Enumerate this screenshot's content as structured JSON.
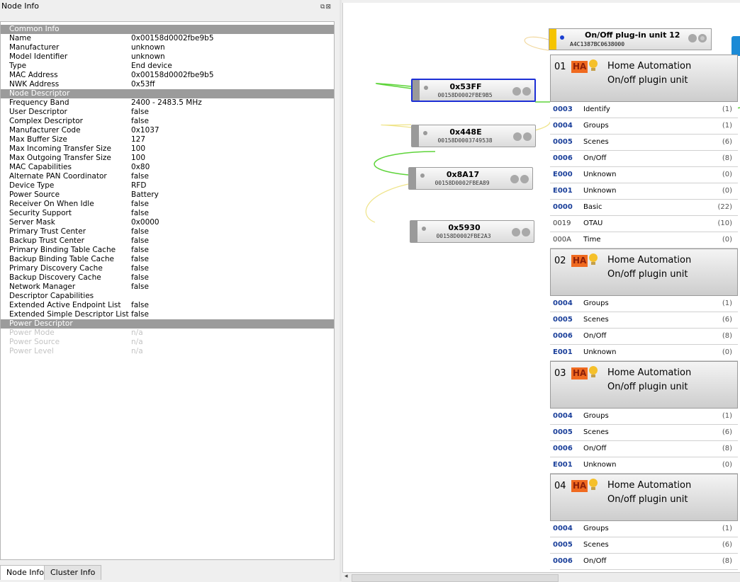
{
  "dock": {
    "title": "Node Info",
    "float_icon": "float-icon",
    "close_icon": "close-icon"
  },
  "node_info": {
    "rows": [
      {
        "kind": "section",
        "key": "Common Info",
        "value": ""
      },
      {
        "kind": "row",
        "key": "Name",
        "value": "0x00158d0002fbe9b5"
      },
      {
        "kind": "row",
        "key": "Manufacturer",
        "value": "unknown"
      },
      {
        "kind": "row",
        "key": "Model Identifier",
        "value": "unknown"
      },
      {
        "kind": "row",
        "key": "Type",
        "value": "End device"
      },
      {
        "kind": "row",
        "key": "MAC Address",
        "value": "0x00158d0002fbe9b5"
      },
      {
        "kind": "row",
        "key": "NWK Address",
        "value": "0x53ff"
      },
      {
        "kind": "section",
        "key": "Node Descriptor",
        "value": ""
      },
      {
        "kind": "row",
        "key": "Frequency Band",
        "value": "2400 - 2483.5 MHz"
      },
      {
        "kind": "row",
        "key": "User Descriptor",
        "value": "false"
      },
      {
        "kind": "row",
        "key": "Complex Descriptor",
        "value": "false"
      },
      {
        "kind": "row",
        "key": "Manufacturer Code",
        "value": "0x1037"
      },
      {
        "kind": "row",
        "key": "Max Buffer Size",
        "value": "127"
      },
      {
        "kind": "row",
        "key": "Max Incoming Transfer Size",
        "value": "100"
      },
      {
        "kind": "row",
        "key": "Max Outgoing Transfer Size",
        "value": "100"
      },
      {
        "kind": "row",
        "key": "MAC Capabilities",
        "value": "0x80"
      },
      {
        "kind": "row",
        "key": "Alternate PAN Coordinator",
        "value": "false"
      },
      {
        "kind": "row",
        "key": "Device Type",
        "value": "RFD"
      },
      {
        "kind": "row",
        "key": "Power Source",
        "value": "Battery"
      },
      {
        "kind": "row",
        "key": "Receiver On When Idle",
        "value": "false"
      },
      {
        "kind": "row",
        "key": "Security Support",
        "value": "false"
      },
      {
        "kind": "row",
        "key": "Server Mask",
        "value": "0x0000"
      },
      {
        "kind": "row",
        "key": "Primary Trust Center",
        "value": "false"
      },
      {
        "kind": "row",
        "key": "Backup Trust Center",
        "value": "false"
      },
      {
        "kind": "row",
        "key": "Primary Binding Table Cache",
        "value": "false"
      },
      {
        "kind": "row",
        "key": "Backup Binding Table Cache",
        "value": "false"
      },
      {
        "kind": "row",
        "key": "Primary Discovery Cache",
        "value": "false"
      },
      {
        "kind": "row",
        "key": "Backup Discovery Cache",
        "value": "false"
      },
      {
        "kind": "row",
        "key": "Network Manager",
        "value": "false"
      },
      {
        "kind": "row",
        "key": "Descriptor Capabilities",
        "value": ""
      },
      {
        "kind": "row",
        "key": "Extended Active Endpoint List",
        "value": "false"
      },
      {
        "kind": "row",
        "key": "Extended Simple Descriptor List",
        "value": "false"
      },
      {
        "kind": "section",
        "key": "Power Descriptor",
        "value": ""
      },
      {
        "kind": "dim",
        "key": "Power Mode",
        "value": "n/a"
      },
      {
        "kind": "dim",
        "key": "Power Source",
        "value": "n/a"
      },
      {
        "kind": "dim",
        "key": "Power Level",
        "value": "n/a"
      }
    ]
  },
  "tabs": [
    {
      "label": "Node Info",
      "active": true
    },
    {
      "label": "Cluster Info",
      "active": false
    }
  ],
  "nodes": [
    {
      "name": "0x53FF",
      "mac": "00158D0002FBE9B5",
      "selected": true
    },
    {
      "name": "0x448E",
      "mac": "00158D0003749538",
      "selected": false
    },
    {
      "name": "0x8A17",
      "mac": "00158D0002FBEA89",
      "selected": false
    },
    {
      "name": "0x5930",
      "mac": "00158D0002FBE2A3",
      "selected": false
    }
  ],
  "plug_node": {
    "name": "On/Off plug-in unit 12",
    "mac": "A4C1387BC0638000",
    "accent": "#f5c400",
    "led": "#1b3fd0"
  },
  "endpoints": [
    {
      "num": "01",
      "badge": "HA",
      "profile": "Home Automation",
      "device": "On/off plugin unit",
      "clusters": [
        {
          "id": "0003",
          "name": "Identify",
          "count": "(1)",
          "side": "client"
        },
        {
          "id": "0004",
          "name": "Groups",
          "count": "(1)",
          "side": "client"
        },
        {
          "id": "0005",
          "name": "Scenes",
          "count": "(6)",
          "side": "client"
        },
        {
          "id": "0006",
          "name": "On/Off",
          "count": "(8)",
          "side": "client"
        },
        {
          "id": "E000",
          "name": "Unknown",
          "count": "(0)",
          "side": "client"
        },
        {
          "id": "E001",
          "name": "Unknown",
          "count": "(0)",
          "side": "client"
        },
        {
          "id": "0000",
          "name": "Basic",
          "count": "(22)",
          "side": "client"
        },
        {
          "id": "0019",
          "name": "OTAU",
          "count": "(10)",
          "side": "server"
        },
        {
          "id": "000A",
          "name": "Time",
          "count": "(0)",
          "side": "server"
        }
      ]
    },
    {
      "num": "02",
      "badge": "HA",
      "profile": "Home Automation",
      "device": "On/off plugin unit",
      "clusters": [
        {
          "id": "0004",
          "name": "Groups",
          "count": "(1)",
          "side": "client"
        },
        {
          "id": "0005",
          "name": "Scenes",
          "count": "(6)",
          "side": "client"
        },
        {
          "id": "0006",
          "name": "On/Off",
          "count": "(8)",
          "side": "client"
        },
        {
          "id": "E001",
          "name": "Unknown",
          "count": "(0)",
          "side": "client"
        }
      ]
    },
    {
      "num": "03",
      "badge": "HA",
      "profile": "Home Automation",
      "device": "On/off plugin unit",
      "clusters": [
        {
          "id": "0004",
          "name": "Groups",
          "count": "(1)",
          "side": "client"
        },
        {
          "id": "0005",
          "name": "Scenes",
          "count": "(6)",
          "side": "client"
        },
        {
          "id": "0006",
          "name": "On/Off",
          "count": "(8)",
          "side": "client"
        },
        {
          "id": "E001",
          "name": "Unknown",
          "count": "(0)",
          "side": "client"
        }
      ]
    },
    {
      "num": "04",
      "badge": "HA",
      "profile": "Home Automation",
      "device": "On/off plugin unit",
      "clusters": [
        {
          "id": "0004",
          "name": "Groups",
          "count": "(1)",
          "side": "client"
        },
        {
          "id": "0005",
          "name": "Scenes",
          "count": "(6)",
          "side": "client"
        },
        {
          "id": "0006",
          "name": "On/Off",
          "count": "(8)",
          "side": "client"
        }
      ]
    }
  ],
  "colors": {
    "section_bg": "#9b9b9b",
    "selected_border": "#1d2fd6",
    "cluster_id": "#1a3f9a",
    "ha_badge": "#f06a20",
    "bulb": "#f5c02a",
    "link_green": "#5ed43a",
    "link_yellow": "#efe48a"
  }
}
